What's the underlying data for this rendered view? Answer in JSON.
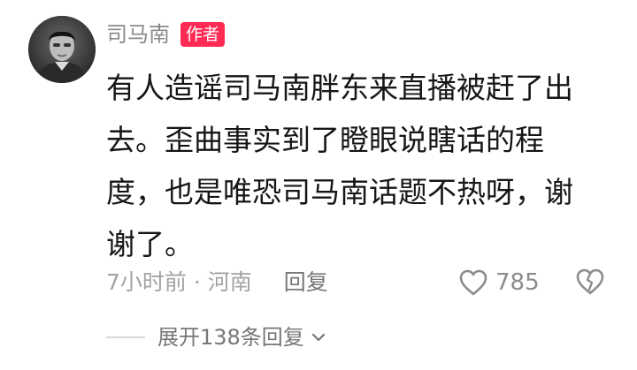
{
  "comment": {
    "author": "司马南",
    "badge": "作者",
    "text": "有人造谣司马南胖东来直播被赶了出去。歪曲事实到了瞪眼说瞎话的程度，也是唯恐司马南话题不热呀，谢谢了。",
    "time_location": "7小时前 · 河南",
    "reply_label": "回复",
    "like_count": "785",
    "expand_label": "展开138条回复"
  },
  "icons": {
    "like": "heart-outline-icon",
    "dislike": "broken-heart-icon",
    "expand": "chevron-down-icon"
  },
  "colors": {
    "badge": "#ff2b54",
    "text": "#161616",
    "secondary": "#a3a3a3"
  }
}
